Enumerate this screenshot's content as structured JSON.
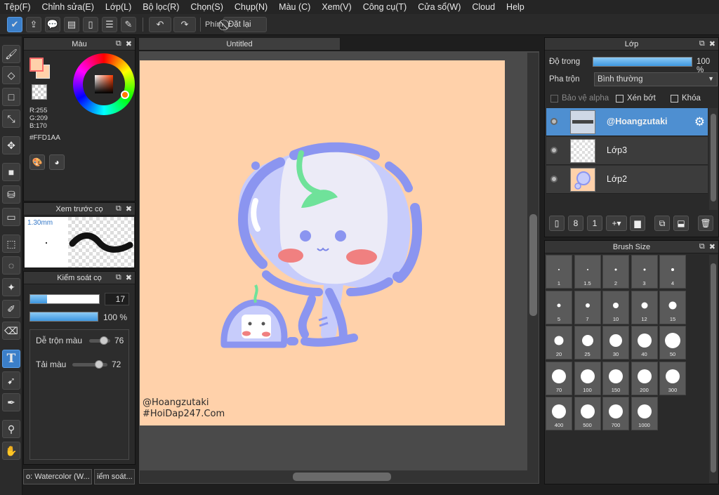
{
  "menu": [
    "Tệp(F)",
    "Chỉnh sửa(E)",
    "Lớp(L)",
    "Bộ lọc(R)",
    "Chọn(S)",
    "Chụp(N)",
    "Màu (C)",
    "Xem(V)",
    "Công cụ(T)",
    "Cửa sổ(W)",
    "Cloud",
    "Help"
  ],
  "toolbar": {
    "phim_label": "Phím",
    "reset_label": "Đặt lại"
  },
  "color_panel": {
    "title": "Màu",
    "r": "R:255",
    "g": "G:209",
    "b": "B:170",
    "hex": "#FFD1AA",
    "fg_color": "#FFD1AA"
  },
  "preview_panel": {
    "title": "Xem trước cọ",
    "size": "1.30mm"
  },
  "brush_control": {
    "title": "Kiểm soát cọ",
    "size_value": "17",
    "size_fraction": 0.24,
    "opacity_value": "100 %",
    "opacity_fraction": 1.0,
    "blend_label": "Dễ trộn màu",
    "blend_value": "76",
    "load_label": "Tải màu",
    "load_value": "72"
  },
  "bottom_tabs": [
    "o: Watercolor (W...",
    "iểm soát..."
  ],
  "canvas": {
    "tab_title": "Untitled",
    "signature_1": "@Hoangzutaki",
    "signature_2": "#HoiDap247.Com",
    "background": "#FFD1AA"
  },
  "layer_panel": {
    "title": "Lớp",
    "opacity_label": "Độ trong",
    "opacity_value": "100 %",
    "blend_label": "Pha trộn",
    "blend_value": "Bình thường",
    "protect_alpha": "Bảo vệ alpha",
    "clipping": "Xén bớt",
    "lock": "Khóa",
    "layers": [
      {
        "name": "@Hoangzutaki",
        "selected": true
      },
      {
        "name": "Lớp3",
        "selected": false
      },
      {
        "name": "Lớp2",
        "selected": false
      }
    ]
  },
  "brush_size_panel": {
    "title": "Brush Size",
    "sizes": [
      "1",
      "1.5",
      "2",
      "3",
      "4",
      "5",
      "7",
      "10",
      "12",
      "15",
      "20",
      "25",
      "30",
      "40",
      "50",
      "70",
      "100",
      "150",
      "200",
      "300",
      "400",
      "500",
      "700",
      "1000"
    ]
  },
  "colors": {
    "accent": "#3b7fc9",
    "canvas_bg": "#FFD1AA",
    "blob": "#8b95f0"
  }
}
